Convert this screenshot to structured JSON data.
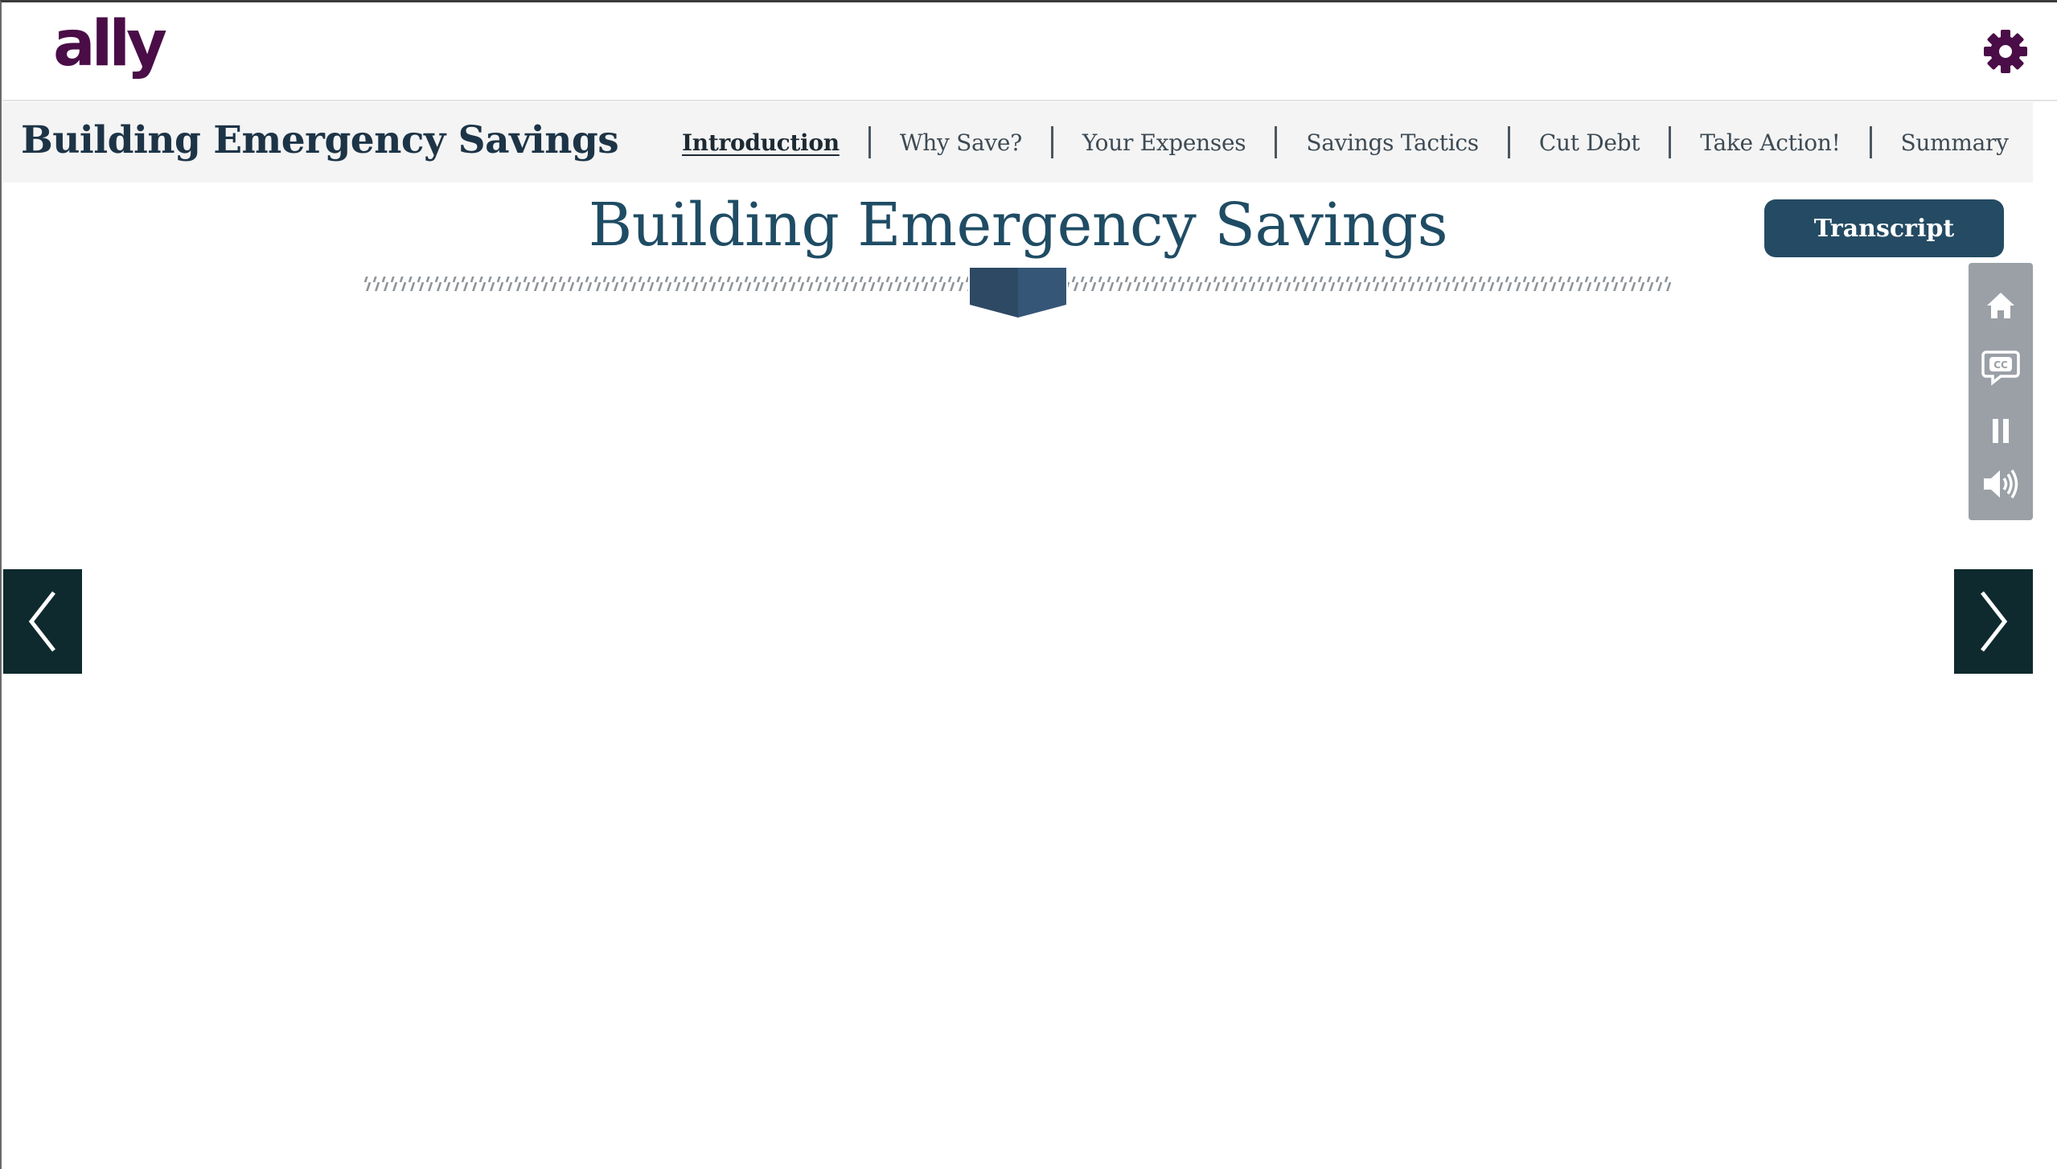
{
  "brand": {
    "logo_text": "ally",
    "logo_color": "#4a0d47"
  },
  "header": {
    "settings_icon": "gear-icon"
  },
  "course": {
    "title": "Building Emergency Savings",
    "nav": [
      {
        "label": "Introduction",
        "active": true
      },
      {
        "label": "Why Save?",
        "active": false
      },
      {
        "label": "Your Expenses",
        "active": false
      },
      {
        "label": "Savings Tactics",
        "active": false
      },
      {
        "label": "Cut Debt",
        "active": false
      },
      {
        "label": "Take Action!",
        "active": false
      },
      {
        "label": "Summary",
        "active": false
      }
    ]
  },
  "slide": {
    "title": "Building Emergency Savings",
    "transcript_label": "Transcript"
  },
  "media_controls": {
    "icons": [
      "home-icon",
      "closed-captions-icon",
      "pause-icon",
      "volume-icon"
    ]
  },
  "navigation": {
    "prev_icon": "chevron-left-icon",
    "next_icon": "chevron-right-icon"
  },
  "colors": {
    "brand_purple": "#4a0d47",
    "title_blue": "#1f4c64",
    "button_blue": "#244b63",
    "arrow_dark": "#0e2a2e",
    "panel_gray": "#9aa0a6"
  }
}
